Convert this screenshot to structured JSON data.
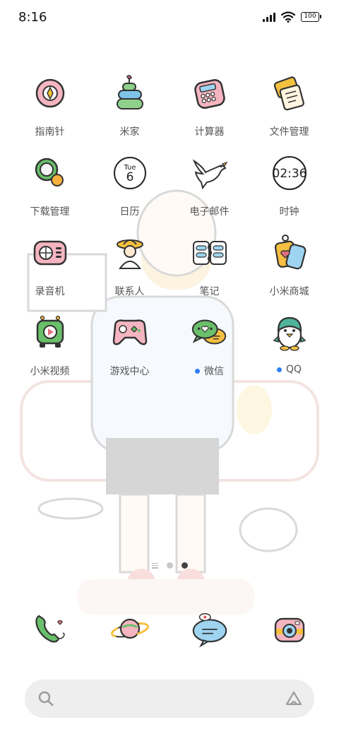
{
  "status_bar": {
    "time": "8:16",
    "battery": "100",
    "icons": [
      "signal-icon",
      "wifi-icon",
      "battery-icon"
    ]
  },
  "apps": [
    {
      "label": "指南针",
      "icon": "compass-icon",
      "badge": false
    },
    {
      "label": "米家",
      "icon": "mijia-icon",
      "badge": false
    },
    {
      "label": "计算器",
      "icon": "calculator-icon",
      "badge": false
    },
    {
      "label": "文件管理",
      "icon": "file-manager-icon",
      "badge": false
    },
    {
      "label": "下载管理",
      "icon": "download-manager-icon",
      "badge": false
    },
    {
      "label": "日历",
      "icon": "calendar-icon",
      "badge": false,
      "day_name": "Tue",
      "day_number": "6"
    },
    {
      "label": "电子邮件",
      "icon": "email-bird-icon",
      "badge": false
    },
    {
      "label": "时钟",
      "icon": "clock-icon",
      "badge": false,
      "time": "02:36"
    },
    {
      "label": "录音机",
      "icon": "recorder-icon",
      "badge": false
    },
    {
      "label": "联系人",
      "icon": "contacts-icon",
      "badge": false
    },
    {
      "label": "笔记",
      "icon": "notes-icon",
      "badge": false
    },
    {
      "label": "小米商城",
      "icon": "mi-store-icon",
      "badge": false
    },
    {
      "label": "小米视频",
      "icon": "mi-video-icon",
      "badge": false
    },
    {
      "label": "游戏中心",
      "icon": "game-center-icon",
      "badge": false
    },
    {
      "label": "微信",
      "icon": "wechat-icon",
      "badge": true
    },
    {
      "label": "QQ",
      "icon": "qq-penguin-icon",
      "badge": true
    }
  ],
  "page_indicator": {
    "pages": 2,
    "active": 2
  },
  "dock": [
    {
      "icon": "phone-icon"
    },
    {
      "icon": "browser-planet-icon"
    },
    {
      "icon": "messages-icon"
    },
    {
      "icon": "camera-icon"
    }
  ],
  "search_bar": {
    "left_icon": "search-icon",
    "right_icon": "assistant-icon"
  },
  "colors": {
    "badge": "#2f7ff5",
    "label": "#555555",
    "search_bg": "#eeeeee"
  }
}
